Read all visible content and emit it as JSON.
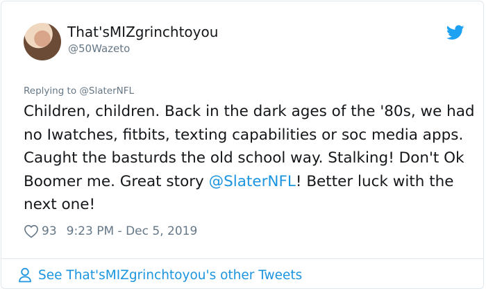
{
  "user": {
    "display_name": "That'sMIZgrinchtoyou",
    "handle": "@50Wazeto"
  },
  "tweet": {
    "replying_to": "Replying to @SlaterNFL",
    "text_main": "Children, children. Back in the dark ages of the '80s, we had no Iwatches, fitbits, texting capabilities or soc media apps. Caught the basturds the old school way. Stalking! Don't Ok Boomer me. Great story ",
    "mention": "@SlaterNFL",
    "text_tail": "! Better luck with the next one!",
    "likes": "93",
    "timestamp": "9:23 PM - Dec 5, 2019"
  },
  "footer": {
    "see_more_label": "See That'sMIZgrinchtoyou's other Tweets"
  },
  "colors": {
    "accent": "#1b95e0",
    "muted": "#657786",
    "text": "#14171a",
    "border": "#e1e8ed"
  },
  "icons": [
    "twitter-bird-icon",
    "heart-icon",
    "person-icon"
  ]
}
